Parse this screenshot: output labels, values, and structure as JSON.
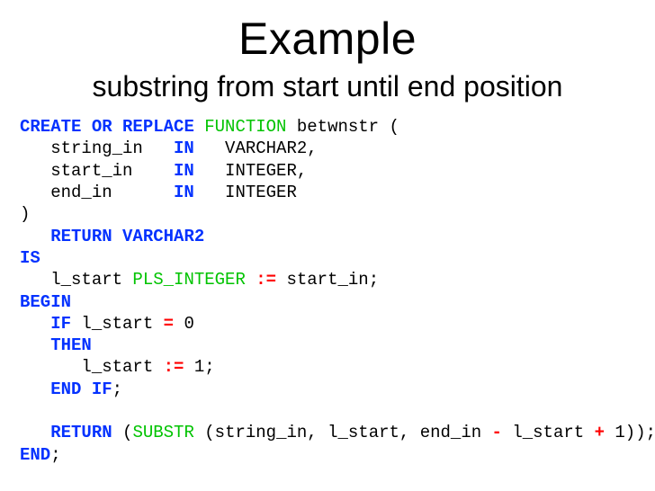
{
  "title": "Example",
  "subtitle": "substring from start until end position",
  "code": {
    "l1a": "CREATE",
    "l1b": " OR REPLACE",
    "l1c": " FUNCTION",
    "l1d": " betwnstr ",
    "l1e": "(",
    "l2a": "   string_in   ",
    "l2b": "IN",
    "l2c": "   VARCHAR2",
    "l2d": ",",
    "l3a": "   start_in    ",
    "l3b": "IN",
    "l3c": "   INTEGER",
    "l3d": ",",
    "l4a": "   end_in      ",
    "l4b": "IN",
    "l4c": "   INTEGER",
    "l5a": ")",
    "l6a": "   RETURN",
    "l6b": " VARCHAR2",
    "l7a": "IS",
    "l8a": "   l_start",
    "l8b": " PLS_INTEGER ",
    "l8c": ":=",
    "l8d": " start_in",
    "l8e": ";",
    "l9a": "BEGIN",
    "l10a": "   IF",
    "l10b": " l_start ",
    "l10c": "=",
    "l10d": " 0",
    "l11a": "   THEN",
    "l12a": "      l_start ",
    "l12b": ":=",
    "l12c": " 1",
    "l12d": ";",
    "l13a": "   END",
    "l13b": " IF",
    "l13c": ";",
    "blank": " ",
    "l15a": "   RETURN",
    "l15b": " (",
    "l15c": "SUBSTR",
    "l15d": " (",
    "l15e": "string_in",
    "l15f": ",",
    "l15g": " l_start",
    "l15h": ",",
    "l15i": " end_in ",
    "l15j": "-",
    "l15k": " l_start ",
    "l15l": "+",
    "l15m": " 1",
    "l15n": "))",
    "l15o": ";",
    "l16a": "END",
    "l16b": ";"
  }
}
